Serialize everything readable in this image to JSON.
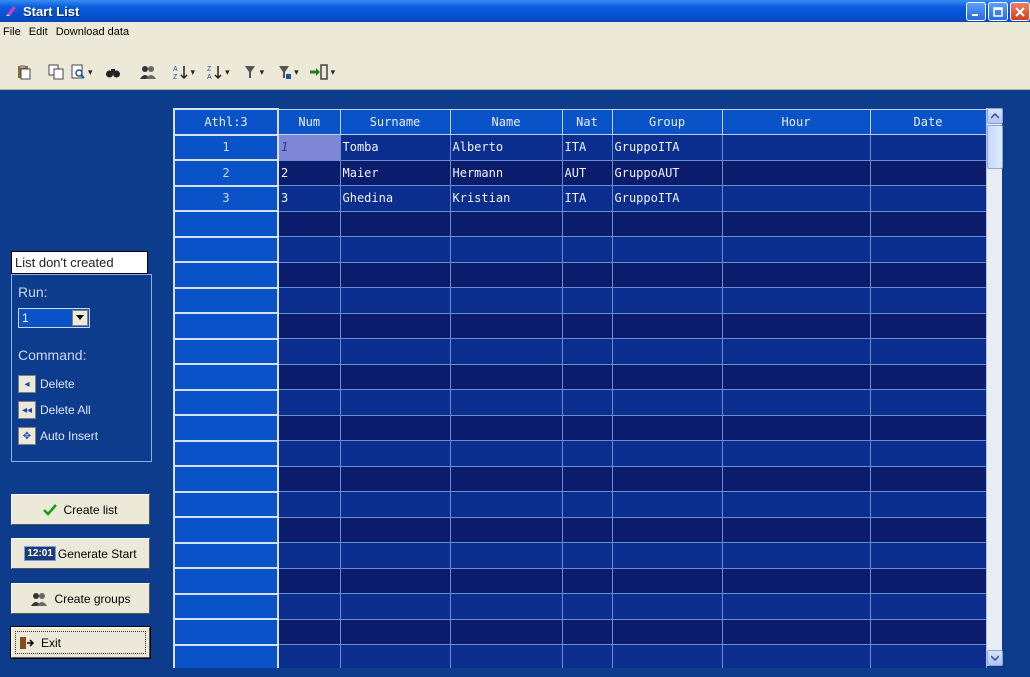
{
  "window": {
    "title": "Start List"
  },
  "menu": [
    "File",
    "Edit",
    "Download data"
  ],
  "toolbar": {
    "icons": [
      "paste-icon",
      "copy-icon",
      "print-preview-icon",
      "find-icon",
      "groups-icon",
      "sort-ascending-icon",
      "sort-descending-icon",
      "filter-icon",
      "filter2-icon",
      "exit-icon"
    ]
  },
  "left_panel": {
    "status": "List don't created",
    "run_label": "Run:",
    "run_value": "1",
    "command_label": "Command:",
    "delete_label": "Delete",
    "delete_all_label": "Delete All",
    "auto_insert_label": "Auto Insert"
  },
  "buttons": {
    "create_list": "Create list",
    "generate_start": "Generate Start",
    "generate_icon_text": "12:01",
    "create_groups": "Create groups",
    "exit": "Exit"
  },
  "grid": {
    "headers": [
      "Athl:3",
      "Num",
      "Surname",
      "Name",
      "Nat",
      "Group",
      "Hour",
      "Date"
    ],
    "rows": [
      {
        "idx": "1",
        "num": "1",
        "surname": "Tomba",
        "name": "Alberto",
        "nat": "ITA",
        "group": "GruppoITA",
        "hour": "",
        "date": ""
      },
      {
        "idx": "2",
        "num": "2",
        "surname": "Maier",
        "name": "Hermann",
        "nat": "AUT",
        "group": "GruppoAUT",
        "hour": "",
        "date": ""
      },
      {
        "idx": "3",
        "num": "3",
        "surname": "Ghedina",
        "name": "Kristian",
        "nat": "ITA",
        "group": "GruppoITA",
        "hour": "",
        "date": ""
      }
    ],
    "empty_rows": 18
  },
  "colors": {
    "background": "#0e3c8c",
    "header_cell": "#0a52c8",
    "row_odd": "#0b2e8e",
    "row_even": "#0c1c6c",
    "current_cell": "#7f86d6"
  }
}
